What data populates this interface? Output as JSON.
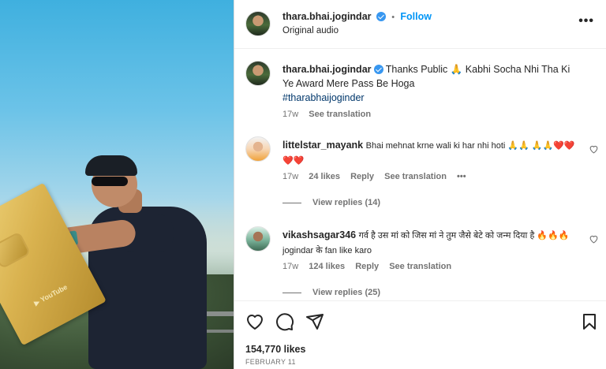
{
  "post": {
    "username": "thara.bhai.jogindar",
    "follow_label": "Follow",
    "audio": "Original audio",
    "caption_text": "Thanks Public 🙏 Kabhi Socha Nhi Tha Ki Ye Award Mere Pass Be Hoga",
    "hashtag": "#tharabhaijoginder",
    "caption_age": "17w",
    "see_translation": "See translation",
    "likes": "154,770 likes",
    "date": "FEBRUARY 11"
  },
  "comments": [
    {
      "username": "littelstar_mayank",
      "text": "Bhai mehnat krne wali ki har nhi hoti 🙏🙏 🙏🙏❤️❤️❤️❤️",
      "age": "17w",
      "likes": "24 likes",
      "reply_label": "Reply",
      "translation_label": "See translation",
      "more": "•••",
      "view_replies": "View replies (14)"
    },
    {
      "username": "vikashsagar346",
      "text": "गर्व है उस मां को जिस मां ने तुम जैसे बेटे को जन्म दिया है 🔥🔥🔥jogindar के fan like karo",
      "age": "17w",
      "likes": "124 likes",
      "reply_label": "Reply",
      "translation_label": "See translation",
      "view_replies": "View replies (25)"
    }
  ],
  "icons": {
    "like": "heart-icon",
    "comment": "comment-icon",
    "share": "share-icon",
    "save": "bookmark-icon",
    "more": "more-options-icon",
    "verified": "verified-badge-icon"
  },
  "colors": {
    "link_blue": "#0095f6",
    "verified_blue": "#3897f0",
    "hashtag": "#00376b",
    "muted": "#737373"
  }
}
